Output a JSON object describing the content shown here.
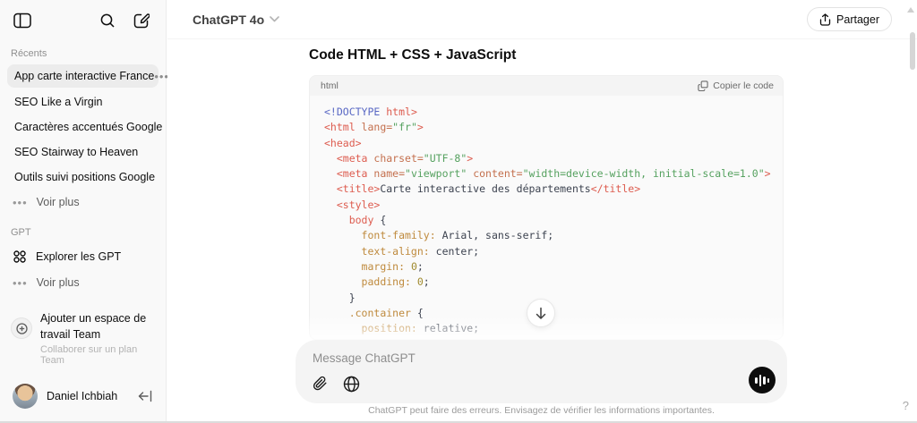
{
  "colors": {
    "sidebar_bg": "#f9f9f9",
    "selected_chat_bg": "#ececec",
    "code_block_bg": "#fafafa",
    "composer_bg": "#f4f4f4",
    "voice_button_bg": "#0d0d0d",
    "token_doctype": "#5968c4",
    "token_tag": "#dd5c4f",
    "token_attribute": "#c4704e",
    "token_string": "#55a15f",
    "token_property": "#bf8a3d"
  },
  "sidebar": {
    "recents_label": "Récents",
    "recent_chats": [
      "App carte interactive France",
      "SEO Like a Virgin",
      "Caractères accentués Google",
      "SEO Stairway to Heaven",
      "Outils suivi positions Google"
    ],
    "voir_plus_recents": "Voir plus",
    "gpt_label": "GPT",
    "explorer_gpt": "Explorer les GPT",
    "voir_plus_gpt": "Voir plus",
    "workspace": {
      "title": "Ajouter un espace de travail Team",
      "subtitle": "Collaborer sur un plan Team"
    },
    "profile": {
      "name": "Daniel Ichbiah"
    }
  },
  "header": {
    "model": "ChatGPT 4o",
    "share_label": "Partager"
  },
  "main": {
    "title": "Code HTML + CSS + JavaScript",
    "code_block": {
      "language": "html",
      "copy_label": "Copier le code",
      "lines": [
        [
          {
            "c": "doc",
            "t": "<!DOCTYPE "
          },
          {
            "c": "tag",
            "t": "html>"
          }
        ],
        [
          {
            "c": "tag",
            "t": "<html"
          },
          {
            "c": "attr",
            "t": " lang="
          },
          {
            "c": "str",
            "t": "\"fr\""
          },
          {
            "c": "tag",
            "t": ">"
          }
        ],
        [
          {
            "c": "tag",
            "t": "<head>"
          }
        ],
        [
          {
            "c": "plain",
            "t": "  "
          },
          {
            "c": "tag",
            "t": "<meta"
          },
          {
            "c": "attr",
            "t": " charset="
          },
          {
            "c": "str",
            "t": "\"UTF-8\""
          },
          {
            "c": "tag",
            "t": ">"
          }
        ],
        [
          {
            "c": "plain",
            "t": "  "
          },
          {
            "c": "tag",
            "t": "<meta"
          },
          {
            "c": "attr",
            "t": " name="
          },
          {
            "c": "str",
            "t": "\"viewport\""
          },
          {
            "c": "attr",
            "t": " content="
          },
          {
            "c": "str",
            "t": "\"width=device-width, initial-scale=1.0\""
          },
          {
            "c": "tag",
            "t": ">"
          }
        ],
        [
          {
            "c": "plain",
            "t": "  "
          },
          {
            "c": "tag",
            "t": "<title>"
          },
          {
            "c": "plain",
            "t": "Carte interactive des départements"
          },
          {
            "c": "tag",
            "t": "</title>"
          }
        ],
        [
          {
            "c": "plain",
            "t": "  "
          },
          {
            "c": "tag",
            "t": "<style>"
          }
        ],
        [
          {
            "c": "plain",
            "t": "    "
          },
          {
            "c": "tag",
            "t": "body"
          },
          {
            "c": "plain",
            "t": " {"
          }
        ],
        [
          {
            "c": "plain",
            "t": "      "
          },
          {
            "c": "prop",
            "t": "font-family:"
          },
          {
            "c": "plain",
            "t": " Arial, sans-serif;"
          }
        ],
        [
          {
            "c": "plain",
            "t": "      "
          },
          {
            "c": "prop",
            "t": "text-align:"
          },
          {
            "c": "plain",
            "t": " center;"
          }
        ],
        [
          {
            "c": "plain",
            "t": "      "
          },
          {
            "c": "prop",
            "t": "margin:"
          },
          {
            "c": "num",
            "t": " 0"
          },
          {
            "c": "plain",
            "t": ";"
          }
        ],
        [
          {
            "c": "plain",
            "t": "      "
          },
          {
            "c": "prop",
            "t": "padding:"
          },
          {
            "c": "num",
            "t": " 0"
          },
          {
            "c": "plain",
            "t": ";"
          }
        ],
        [
          {
            "c": "plain",
            "t": "    }"
          }
        ],
        [
          {
            "c": "plain",
            "t": "    "
          },
          {
            "c": "sel",
            "t": ".container"
          },
          {
            "c": "plain",
            "t": " {"
          }
        ],
        [
          {
            "c": "plain",
            "t": "      "
          },
          {
            "c": "prop",
            "t": "position:"
          },
          {
            "c": "plain",
            "t": " relative;"
          }
        ]
      ]
    }
  },
  "composer": {
    "placeholder": "Message ChatGPT"
  },
  "footer": {
    "disclaimer": "ChatGPT peut faire des erreurs. Envisagez de vérifier les informations importantes."
  },
  "help_label": "?"
}
